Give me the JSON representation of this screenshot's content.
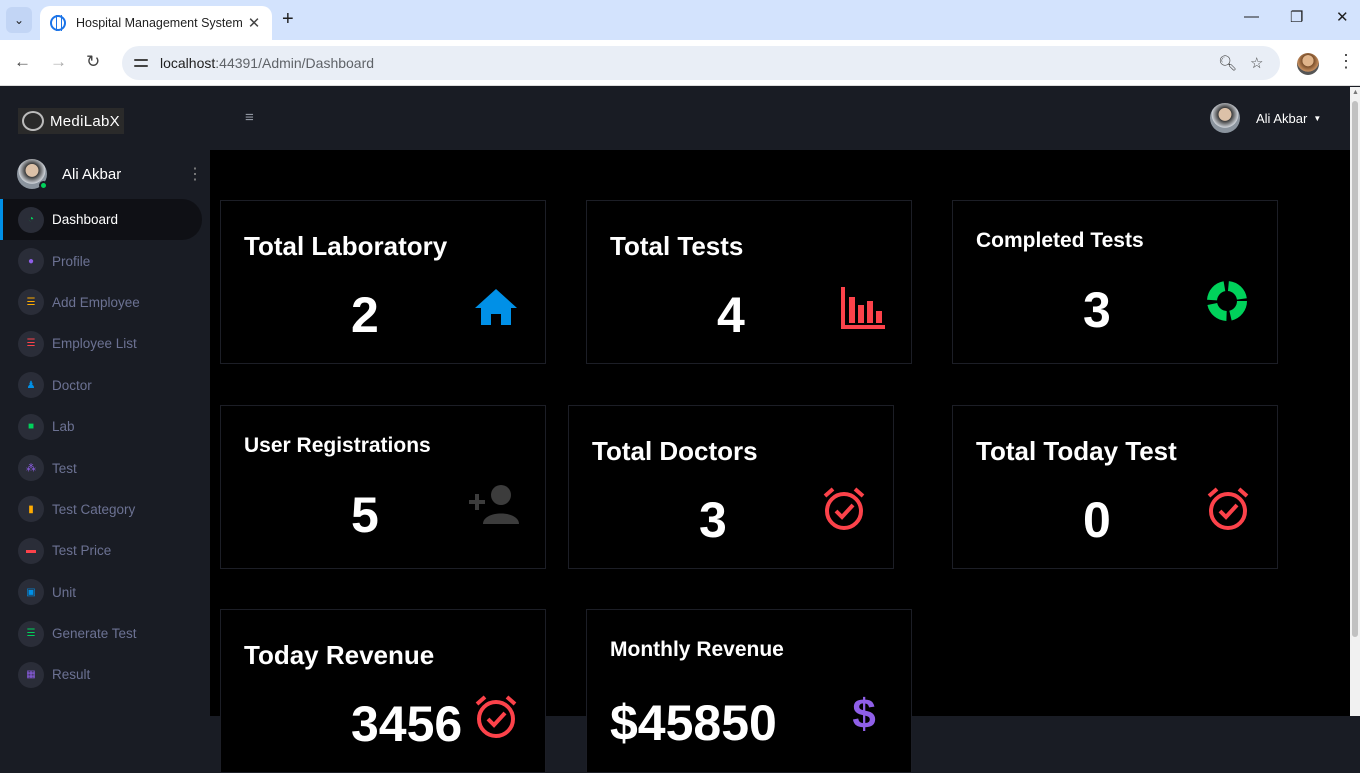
{
  "browser": {
    "tab_title": "Hospital Management System",
    "url_host": "localhost",
    "url_path": ":44391/Admin/Dashboard"
  },
  "sidebar": {
    "logo": "MediLabX",
    "user_name": "Ali Akbar",
    "items": [
      {
        "label": "Dashboard",
        "icon": "dashboard-icon",
        "color": "#00d25b"
      },
      {
        "label": "Profile",
        "icon": "person-icon",
        "color": "#8f5fe8"
      },
      {
        "label": "Add Employee",
        "icon": "list-add-icon",
        "color": "#ffab00"
      },
      {
        "label": "Employee List",
        "icon": "list-icon",
        "color": "#fc424a"
      },
      {
        "label": "Doctor",
        "icon": "doctor-icon",
        "color": "#0090e7"
      },
      {
        "label": "Lab",
        "icon": "briefcase-icon",
        "color": "#00d25b"
      },
      {
        "label": "Test",
        "icon": "molecule-icon",
        "color": "#8f5fe8"
      },
      {
        "label": "Test Category",
        "icon": "bar-chart-icon",
        "color": "#ffab00"
      },
      {
        "label": "Test Price",
        "icon": "wallet-icon",
        "color": "#fc424a"
      },
      {
        "label": "Unit",
        "icon": "card-icon",
        "color": "#0090e7"
      },
      {
        "label": "Generate Test",
        "icon": "list-check-icon",
        "color": "#00d25b"
      },
      {
        "label": "Result",
        "icon": "grid-icon",
        "color": "#8f5fe8"
      }
    ]
  },
  "topnav": {
    "user_name": "Ali Akbar"
  },
  "cards": [
    {
      "title": "Total Laboratory",
      "value": "2",
      "icon": "home-icon",
      "color": "#0090e7"
    },
    {
      "title": "Total Tests",
      "value": "4",
      "icon": "bar-chart-icon",
      "color": "#fc424a"
    },
    {
      "title": "Completed Tests",
      "value": "3",
      "icon": "donut-chart-icon",
      "color": "#00d25b"
    },
    {
      "title": "User Registrations",
      "value": "5",
      "icon": "add-user-icon",
      "color": "#3c3c3c"
    },
    {
      "title": "Total Doctors",
      "value": "3",
      "icon": "alarm-check-icon",
      "color": "#fc424a"
    },
    {
      "title": "Total Today Test",
      "value": "0",
      "icon": "alarm-check-icon",
      "color": "#fc424a"
    },
    {
      "title": "Today Revenue",
      "value": "3456",
      "icon": "alarm-check-icon",
      "color": "#fc424a"
    },
    {
      "title": "Monthly Revenue",
      "value": "$45850",
      "icon": "dollar-icon",
      "color": "#8f5fe8"
    }
  ]
}
